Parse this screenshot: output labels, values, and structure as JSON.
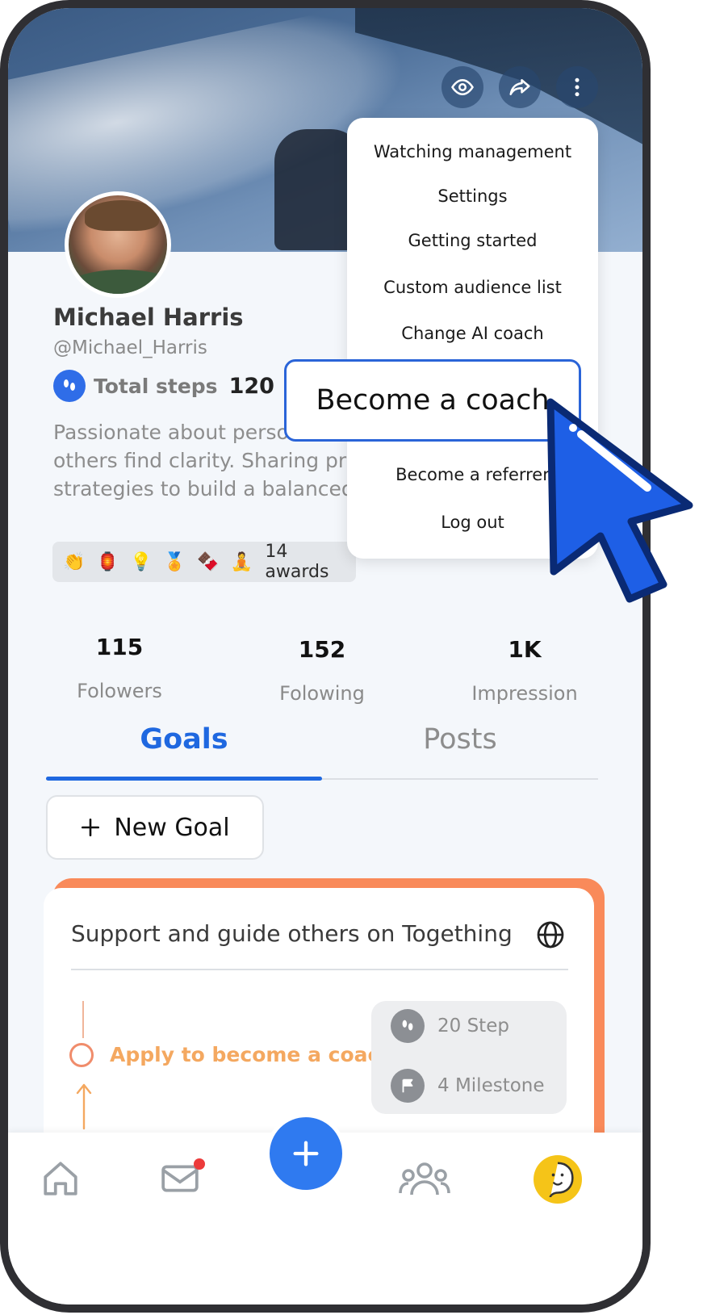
{
  "profile": {
    "name": "Michael Harris",
    "handle": "@Michael_Harris",
    "steps_label": "Total steps",
    "steps_value": "120",
    "bio_lines": [
      "Passionate about person",
      "others find clarity. Sharing proc",
      "strategies to build a balanced li"
    ]
  },
  "awards": {
    "icons": [
      "clapping-hands-icon",
      "lantern-icon",
      "light-bulb-icon",
      "medal-icon",
      "chocolate-icon",
      "monk-icon"
    ],
    "count_label": "14 awards"
  },
  "stats": [
    {
      "value": "115",
      "label": "Folowers"
    },
    {
      "value": "152",
      "label": "Folowing"
    },
    {
      "value": "1K",
      "label": "Impression"
    }
  ],
  "tabs": {
    "goals": "Goals",
    "posts": "Posts"
  },
  "new_goal": {
    "icon": "plus-icon",
    "label": "New Goal"
  },
  "goal_card": {
    "title": "Support and guide others on Togething",
    "task": "Apply to become a coach",
    "steps": "20 Step",
    "milestones": "4 Milestone"
  },
  "menu": {
    "items": [
      "Watching management",
      "Settings",
      "Getting started",
      "Custom audience list",
      "Change AI coach",
      "Become a coach",
      "Become a referrer",
      "Log out"
    ],
    "highlighted": "Become a coach"
  },
  "colors": {
    "accent": "#1f68e0",
    "fab": "#2f7af0",
    "goal_border": "#f98a5a",
    "task_text": "#f4a860",
    "cursor": "#1e5fe6",
    "notification": "#ec3b3b",
    "ai_avatar": "#f5c418"
  }
}
